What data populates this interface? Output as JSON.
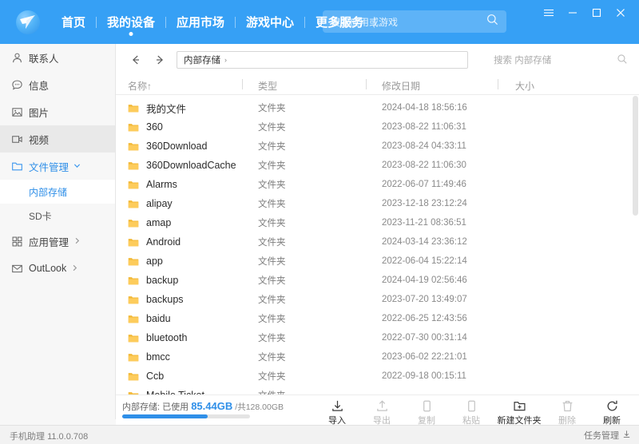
{
  "header": {
    "logo_icon": "paper-plane-logo",
    "nav": [
      {
        "label": "首页",
        "active": false
      },
      {
        "label": "我的设备",
        "active": true
      },
      {
        "label": "应用市场",
        "active": false
      },
      {
        "label": "游戏中心",
        "active": false
      },
      {
        "label": "更多服务",
        "active": false
      }
    ],
    "search": {
      "placeholder": "搜索应用或游戏",
      "value": "",
      "icon": "search-icon"
    },
    "window_controls": [
      {
        "name": "menu-icon",
        "glyph": "☰"
      },
      {
        "name": "minimize-icon",
        "glyph": "−"
      },
      {
        "name": "maximize-icon",
        "glyph": "□"
      },
      {
        "name": "close-icon",
        "glyph": "✕"
      }
    ],
    "accent_color": "#36a0f5"
  },
  "sidebar": {
    "items": [
      {
        "label": "联系人",
        "icon": "person-icon",
        "state": "normal"
      },
      {
        "label": "信息",
        "icon": "chat-bubble-icon",
        "state": "normal"
      },
      {
        "label": "图片",
        "icon": "image-icon",
        "state": "normal"
      },
      {
        "label": "视频",
        "icon": "video-camera-icon",
        "state": "hover"
      },
      {
        "label": "文件管理",
        "icon": "folder-icon",
        "state": "active",
        "chevron": "⌄",
        "expanded": true
      }
    ],
    "sub_items": [
      {
        "label": "内部存储",
        "selected": true
      },
      {
        "label": "SD卡",
        "selected": false
      }
    ],
    "items_after": [
      {
        "label": "应用管理",
        "icon": "grid-icon",
        "state": "normal",
        "chevron": "›"
      },
      {
        "label": "OutLook",
        "icon": "envelope-icon",
        "state": "normal",
        "chevron": "›"
      }
    ]
  },
  "toolbar": {
    "back_icon": "arrow-left-icon",
    "forward_icon": "arrow-right-icon",
    "path_value": "内部存储",
    "path_separator": "›",
    "file_search_placeholder": "搜索 内部存储",
    "file_search_icon": "search-icon"
  },
  "columns": [
    {
      "label": "名称",
      "sort": "↑"
    },
    {
      "label": "类型",
      "sort": ""
    },
    {
      "label": "修改日期",
      "sort": ""
    },
    {
      "label": "大小",
      "sort": ""
    }
  ],
  "files": [
    {
      "name": "我的文件",
      "type": "文件夹",
      "date": "2024-04-18 18:56:16",
      "size": "",
      "icon": "folder-icon"
    },
    {
      "name": "360",
      "type": "文件夹",
      "date": "2023-08-22 11:06:31",
      "size": "",
      "icon": "folder-icon"
    },
    {
      "name": "360Download",
      "type": "文件夹",
      "date": "2023-08-24 04:33:11",
      "size": "",
      "icon": "folder-icon"
    },
    {
      "name": "360DownloadCache",
      "type": "文件夹",
      "date": "2023-08-22 11:06:30",
      "size": "",
      "icon": "folder-icon"
    },
    {
      "name": "Alarms",
      "type": "文件夹",
      "date": "2022-06-07 11:49:46",
      "size": "",
      "icon": "folder-icon"
    },
    {
      "name": "alipay",
      "type": "文件夹",
      "date": "2023-12-18 23:12:24",
      "size": "",
      "icon": "folder-icon"
    },
    {
      "name": "amap",
      "type": "文件夹",
      "date": "2023-11-21 08:36:51",
      "size": "",
      "icon": "folder-icon"
    },
    {
      "name": "Android",
      "type": "文件夹",
      "date": "2024-03-14 23:36:12",
      "size": "",
      "icon": "folder-icon"
    },
    {
      "name": "app",
      "type": "文件夹",
      "date": "2022-06-04 15:22:14",
      "size": "",
      "icon": "folder-icon"
    },
    {
      "name": "backup",
      "type": "文件夹",
      "date": "2024-04-19 02:56:46",
      "size": "",
      "icon": "folder-icon"
    },
    {
      "name": "backups",
      "type": "文件夹",
      "date": "2023-07-20 13:49:07",
      "size": "",
      "icon": "folder-icon"
    },
    {
      "name": "baidu",
      "type": "文件夹",
      "date": "2022-06-25 12:43:56",
      "size": "",
      "icon": "folder-icon"
    },
    {
      "name": "bluetooth",
      "type": "文件夹",
      "date": "2022-07-30 00:31:14",
      "size": "",
      "icon": "folder-icon"
    },
    {
      "name": "bmcc",
      "type": "文件夹",
      "date": "2023-06-02 22:21:01",
      "size": "",
      "icon": "folder-icon"
    },
    {
      "name": "Ccb",
      "type": "文件夹",
      "date": "2022-09-18 00:15:11",
      "size": "",
      "icon": "folder-icon"
    },
    {
      "name": "Mobile Ticket",
      "type": "文件夹",
      "date": "",
      "size": "",
      "icon": "folder-icon"
    }
  ],
  "bottom": {
    "storage_label": "内部存储:",
    "storage_used_prefix": "已使用",
    "storage_used": "85.44GB",
    "storage_total": "/共128.00GB",
    "storage_percent": 67,
    "actions": [
      {
        "label": "导入",
        "icon": "import-download-icon",
        "enabled": true
      },
      {
        "label": "导出",
        "icon": "export-upload-icon",
        "enabled": false
      },
      {
        "label": "复制",
        "icon": "copy-icon",
        "enabled": false
      },
      {
        "label": "粘贴",
        "icon": "paste-icon",
        "enabled": false
      },
      {
        "label": "新建文件夹",
        "icon": "new-folder-icon",
        "enabled": true
      },
      {
        "label": "删除",
        "icon": "trash-icon",
        "enabled": false
      },
      {
        "label": "刷新",
        "icon": "refresh-icon",
        "enabled": true
      }
    ]
  },
  "status": {
    "app_name": "手机助理",
    "version": "11.0.0.708",
    "task_manager": "任务管理",
    "task_manager_icon": "download-arrow-icon"
  }
}
